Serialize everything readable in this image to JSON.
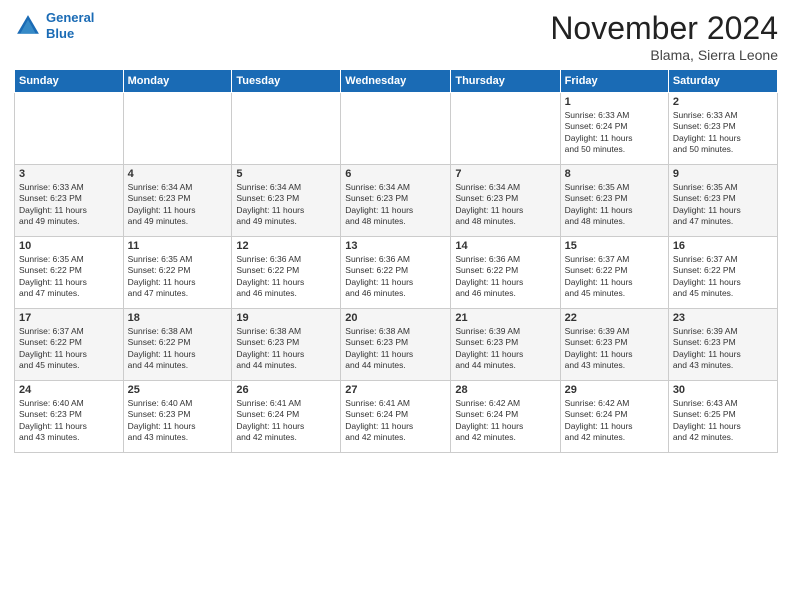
{
  "header": {
    "logo_line1": "General",
    "logo_line2": "Blue",
    "month": "November 2024",
    "location": "Blama, Sierra Leone"
  },
  "weekdays": [
    "Sunday",
    "Monday",
    "Tuesday",
    "Wednesday",
    "Thursday",
    "Friday",
    "Saturday"
  ],
  "weeks": [
    [
      {
        "day": "",
        "info": ""
      },
      {
        "day": "",
        "info": ""
      },
      {
        "day": "",
        "info": ""
      },
      {
        "day": "",
        "info": ""
      },
      {
        "day": "",
        "info": ""
      },
      {
        "day": "1",
        "info": "Sunrise: 6:33 AM\nSunset: 6:24 PM\nDaylight: 11 hours\nand 50 minutes."
      },
      {
        "day": "2",
        "info": "Sunrise: 6:33 AM\nSunset: 6:23 PM\nDaylight: 11 hours\nand 50 minutes."
      }
    ],
    [
      {
        "day": "3",
        "info": "Sunrise: 6:33 AM\nSunset: 6:23 PM\nDaylight: 11 hours\nand 49 minutes."
      },
      {
        "day": "4",
        "info": "Sunrise: 6:34 AM\nSunset: 6:23 PM\nDaylight: 11 hours\nand 49 minutes."
      },
      {
        "day": "5",
        "info": "Sunrise: 6:34 AM\nSunset: 6:23 PM\nDaylight: 11 hours\nand 49 minutes."
      },
      {
        "day": "6",
        "info": "Sunrise: 6:34 AM\nSunset: 6:23 PM\nDaylight: 11 hours\nand 48 minutes."
      },
      {
        "day": "7",
        "info": "Sunrise: 6:34 AM\nSunset: 6:23 PM\nDaylight: 11 hours\nand 48 minutes."
      },
      {
        "day": "8",
        "info": "Sunrise: 6:35 AM\nSunset: 6:23 PM\nDaylight: 11 hours\nand 48 minutes."
      },
      {
        "day": "9",
        "info": "Sunrise: 6:35 AM\nSunset: 6:23 PM\nDaylight: 11 hours\nand 47 minutes."
      }
    ],
    [
      {
        "day": "10",
        "info": "Sunrise: 6:35 AM\nSunset: 6:22 PM\nDaylight: 11 hours\nand 47 minutes."
      },
      {
        "day": "11",
        "info": "Sunrise: 6:35 AM\nSunset: 6:22 PM\nDaylight: 11 hours\nand 47 minutes."
      },
      {
        "day": "12",
        "info": "Sunrise: 6:36 AM\nSunset: 6:22 PM\nDaylight: 11 hours\nand 46 minutes."
      },
      {
        "day": "13",
        "info": "Sunrise: 6:36 AM\nSunset: 6:22 PM\nDaylight: 11 hours\nand 46 minutes."
      },
      {
        "day": "14",
        "info": "Sunrise: 6:36 AM\nSunset: 6:22 PM\nDaylight: 11 hours\nand 46 minutes."
      },
      {
        "day": "15",
        "info": "Sunrise: 6:37 AM\nSunset: 6:22 PM\nDaylight: 11 hours\nand 45 minutes."
      },
      {
        "day": "16",
        "info": "Sunrise: 6:37 AM\nSunset: 6:22 PM\nDaylight: 11 hours\nand 45 minutes."
      }
    ],
    [
      {
        "day": "17",
        "info": "Sunrise: 6:37 AM\nSunset: 6:22 PM\nDaylight: 11 hours\nand 45 minutes."
      },
      {
        "day": "18",
        "info": "Sunrise: 6:38 AM\nSunset: 6:22 PM\nDaylight: 11 hours\nand 44 minutes."
      },
      {
        "day": "19",
        "info": "Sunrise: 6:38 AM\nSunset: 6:23 PM\nDaylight: 11 hours\nand 44 minutes."
      },
      {
        "day": "20",
        "info": "Sunrise: 6:38 AM\nSunset: 6:23 PM\nDaylight: 11 hours\nand 44 minutes."
      },
      {
        "day": "21",
        "info": "Sunrise: 6:39 AM\nSunset: 6:23 PM\nDaylight: 11 hours\nand 44 minutes."
      },
      {
        "day": "22",
        "info": "Sunrise: 6:39 AM\nSunset: 6:23 PM\nDaylight: 11 hours\nand 43 minutes."
      },
      {
        "day": "23",
        "info": "Sunrise: 6:39 AM\nSunset: 6:23 PM\nDaylight: 11 hours\nand 43 minutes."
      }
    ],
    [
      {
        "day": "24",
        "info": "Sunrise: 6:40 AM\nSunset: 6:23 PM\nDaylight: 11 hours\nand 43 minutes."
      },
      {
        "day": "25",
        "info": "Sunrise: 6:40 AM\nSunset: 6:23 PM\nDaylight: 11 hours\nand 43 minutes."
      },
      {
        "day": "26",
        "info": "Sunrise: 6:41 AM\nSunset: 6:24 PM\nDaylight: 11 hours\nand 42 minutes."
      },
      {
        "day": "27",
        "info": "Sunrise: 6:41 AM\nSunset: 6:24 PM\nDaylight: 11 hours\nand 42 minutes."
      },
      {
        "day": "28",
        "info": "Sunrise: 6:42 AM\nSunset: 6:24 PM\nDaylight: 11 hours\nand 42 minutes."
      },
      {
        "day": "29",
        "info": "Sunrise: 6:42 AM\nSunset: 6:24 PM\nDaylight: 11 hours\nand 42 minutes."
      },
      {
        "day": "30",
        "info": "Sunrise: 6:43 AM\nSunset: 6:25 PM\nDaylight: 11 hours\nand 42 minutes."
      }
    ]
  ]
}
